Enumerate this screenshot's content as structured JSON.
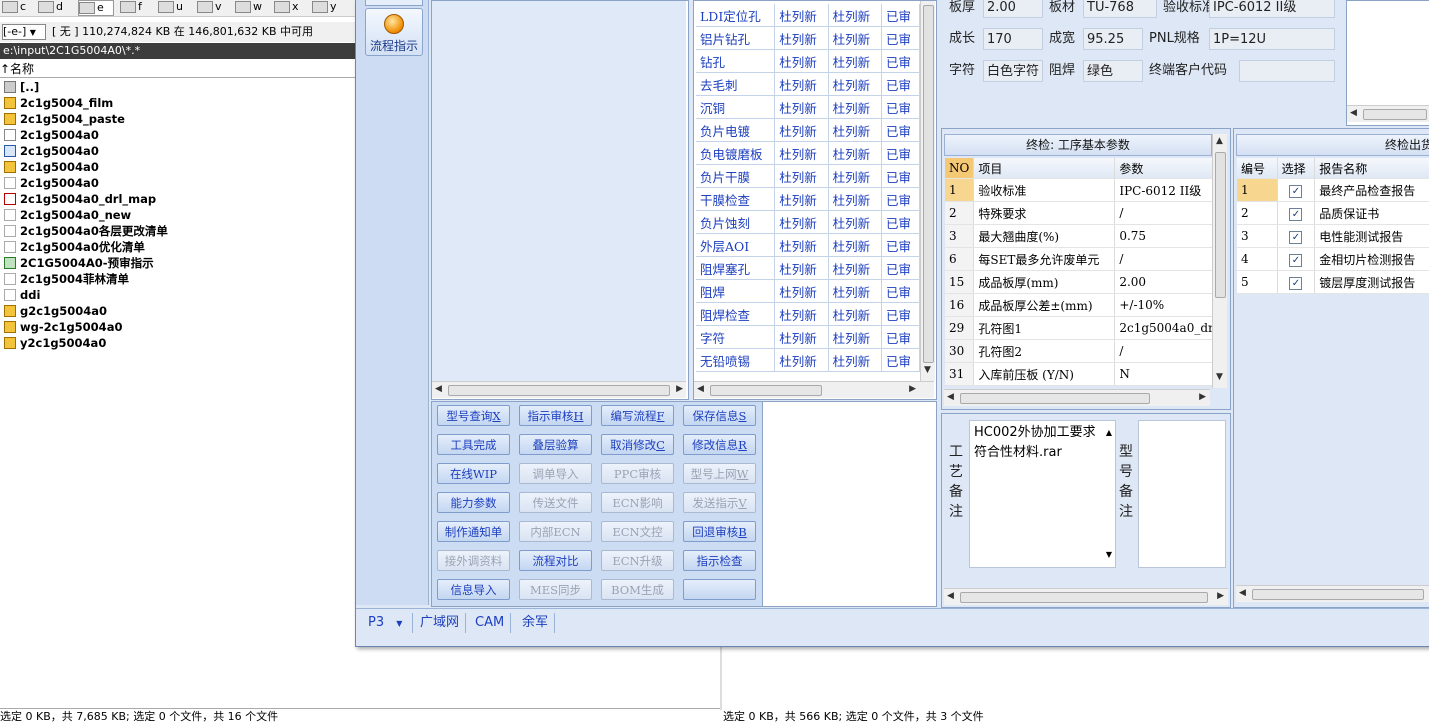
{
  "drives": [
    {
      "letter": "c"
    },
    {
      "letter": "d"
    },
    {
      "letter": "e"
    },
    {
      "letter": "f"
    },
    {
      "letter": "u"
    },
    {
      "letter": "v"
    },
    {
      "letter": "w"
    },
    {
      "letter": "x"
    },
    {
      "letter": "y"
    }
  ],
  "freebar": {
    "combo": "[-e-]",
    "text": "[ 无 ]  110,274,824 KB 在  146,801,632 KB 中可用"
  },
  "path": "e:\\input\\2C1G5004A0\\*.*",
  "column_header": "↑名称",
  "files": [
    {
      "name": "[..]",
      "icon": "up-folder-icon"
    },
    {
      "name": "2c1g5004_film",
      "icon": "archive-icon"
    },
    {
      "name": "2c1g5004_paste",
      "icon": "archive-icon"
    },
    {
      "name": "2c1g5004a0",
      "icon": "file-icon"
    },
    {
      "name": "2c1g5004a0",
      "icon": "window-file-icon"
    },
    {
      "name": "2c1g5004a0",
      "icon": "archive-icon"
    },
    {
      "name": "2c1g5004a0",
      "icon": "text-file-icon"
    },
    {
      "name": "2c1g5004a0_drl_map",
      "icon": "pdf-icon"
    },
    {
      "name": "2c1g5004a0_new",
      "icon": "text-file-icon"
    },
    {
      "name": "2c1g5004a0各层更改清单",
      "icon": "text-file-icon"
    },
    {
      "name": "2c1g5004a0优化清单",
      "icon": "text-file-icon"
    },
    {
      "name": "2C1G5004A0-预审指示",
      "icon": "excel-icon"
    },
    {
      "name": "2c1g5004菲林清单",
      "icon": "text-file-icon"
    },
    {
      "name": "ddi",
      "icon": "text-file-icon"
    },
    {
      "name": "g2c1g5004a0",
      "icon": "archive-icon"
    },
    {
      "name": "wg-2c1g5004a0",
      "icon": "archive-icon"
    },
    {
      "name": "y2c1g5004a0",
      "icon": "archive-icon"
    }
  ],
  "status_left": "选定 0 KB，共 7,685 KB; 选定 0 个文件，共 16 个文件",
  "status_right": "选定 0 KB，共 566 KB; 选定 0 个文件，共 3 个文件",
  "app": {
    "flow_button": "流程指示",
    "process_rows": [
      [
        "LDI定位孔",
        "杜列新",
        "杜列新",
        "已审"
      ],
      [
        "铝片钻孔",
        "杜列新",
        "杜列新",
        "已审"
      ],
      [
        "钻孔",
        "杜列新",
        "杜列新",
        "已审"
      ],
      [
        "去毛刺",
        "杜列新",
        "杜列新",
        "已审"
      ],
      [
        "沉铜",
        "杜列新",
        "杜列新",
        "已审"
      ],
      [
        "负片电镀",
        "杜列新",
        "杜列新",
        "已审"
      ],
      [
        "负电镀磨板",
        "杜列新",
        "杜列新",
        "已审"
      ],
      [
        "负片干膜",
        "杜列新",
        "杜列新",
        "已审"
      ],
      [
        "干膜检查",
        "杜列新",
        "杜列新",
        "已审"
      ],
      [
        "负片蚀刻",
        "杜列新",
        "杜列新",
        "已审"
      ],
      [
        "外层AOI",
        "杜列新",
        "杜列新",
        "已审"
      ],
      [
        "阻焊塞孔",
        "杜列新",
        "杜列新",
        "已审"
      ],
      [
        "阻焊",
        "杜列新",
        "杜列新",
        "已审"
      ],
      [
        "阻焊检查",
        "杜列新",
        "杜列新",
        "已审"
      ],
      [
        "字符",
        "杜列新",
        "杜列新",
        "已审"
      ],
      [
        "无铅喷锡",
        "杜列新",
        "杜列新",
        "已审"
      ]
    ],
    "buttons": [
      {
        "label": "型号查询",
        "key": "X",
        "enabled": true
      },
      {
        "label": "指示审核",
        "key": "H",
        "enabled": true
      },
      {
        "label": "编写流程",
        "key": "F",
        "enabled": true
      },
      {
        "label": "保存信息",
        "key": "S",
        "enabled": true
      },
      {
        "label": "工具完成",
        "key": "",
        "enabled": true
      },
      {
        "label": "叠层验算",
        "key": "",
        "enabled": true
      },
      {
        "label": "取消修改",
        "key": "C",
        "enabled": true
      },
      {
        "label": "修改信息",
        "key": "R",
        "enabled": true
      },
      {
        "label": "在线WIP",
        "key": "",
        "enabled": true
      },
      {
        "label": "调单导入",
        "key": "",
        "enabled": false
      },
      {
        "label": "PPC审核",
        "key": "",
        "enabled": false
      },
      {
        "label": "型号上网",
        "key": "W",
        "enabled": false
      },
      {
        "label": "能力参数",
        "key": "",
        "enabled": true
      },
      {
        "label": "传送文件",
        "key": "",
        "enabled": false
      },
      {
        "label": "ECN影响",
        "key": "",
        "enabled": false
      },
      {
        "label": "发送指示",
        "key": "V",
        "enabled": false
      },
      {
        "label": "制作通知单",
        "key": "",
        "enabled": true
      },
      {
        "label": "内部ECN",
        "key": "",
        "enabled": false
      },
      {
        "label": "ECN文控",
        "key": "",
        "enabled": false
      },
      {
        "label": "回退审核",
        "key": "B",
        "enabled": true
      },
      {
        "label": "接外调资料",
        "key": "",
        "enabled": false
      },
      {
        "label": "流程对比",
        "key": "",
        "enabled": true
      },
      {
        "label": "ECN升级",
        "key": "",
        "enabled": false
      },
      {
        "label": "指示检查",
        "key": "",
        "enabled": true
      },
      {
        "label": "信息导入",
        "key": "",
        "enabled": true
      },
      {
        "label": "MES同步",
        "key": "",
        "enabled": false
      },
      {
        "label": "BOM生成",
        "key": "",
        "enabled": false
      },
      {
        "label": "",
        "key": "",
        "enabled": true
      }
    ],
    "info": {
      "board_thickness_label": "板厚",
      "board_thickness": "2.00",
      "material_label": "板材",
      "material": "TU-768",
      "acceptance_label": "验收标准",
      "acceptance": "IPC-6012 II级",
      "length_label": "成长",
      "length": "170",
      "width_label": "成宽",
      "width": "95.25",
      "pnl_label": "PNL规格",
      "pnl": "1P=12U",
      "char_label": "字符",
      "char": "白色字符",
      "mask_label": "阻焊",
      "mask": "绿色",
      "customer_label": "终端客户代码",
      "customer": ""
    },
    "params": {
      "title": "终检: 工序基本参数",
      "headers": [
        "NO",
        "项目",
        "参数"
      ],
      "rows": [
        [
          "1",
          "验收标准",
          "IPC-6012 II级"
        ],
        [
          "2",
          "特殊要求",
          "/"
        ],
        [
          "3",
          "最大翘曲度(%)",
          "0.75"
        ],
        [
          "6",
          "每SET最多允许废单元",
          "/"
        ],
        [
          "15",
          "成品板厚(mm)",
          "2.00"
        ],
        [
          "16",
          "成品板厚公差±(mm)",
          "+/-10%"
        ],
        [
          "29",
          "孔符图1",
          "2c1g5004a0_dr"
        ],
        [
          "30",
          "孔符图2",
          "/"
        ],
        [
          "31",
          "入库前压板 (Y/N)",
          "N"
        ]
      ]
    },
    "reports": {
      "title": "终检出货",
      "headers": [
        "编号",
        "选择",
        "报告名称"
      ],
      "rows": [
        [
          "1",
          "✓",
          "最终产品检查报告"
        ],
        [
          "2",
          "✓",
          "品质保证书"
        ],
        [
          "3",
          "✓",
          "电性能测试报告"
        ],
        [
          "4",
          "✓",
          "金相切片检测报告"
        ],
        [
          "5",
          "✓",
          "镀层厚度测试报告"
        ]
      ]
    },
    "notes": {
      "process_label": "工艺备注",
      "process_text": "HC002外协加工要求符合性材料.rar",
      "model_label": "型号备注",
      "model_text": ""
    },
    "status_tabs": [
      "P3",
      "广域网",
      "CAM",
      "余军"
    ]
  },
  "colors": {
    "accent_text": "#1d3fbf",
    "panel_bg": "#dde7f5",
    "selected_row": "#f7d690"
  }
}
